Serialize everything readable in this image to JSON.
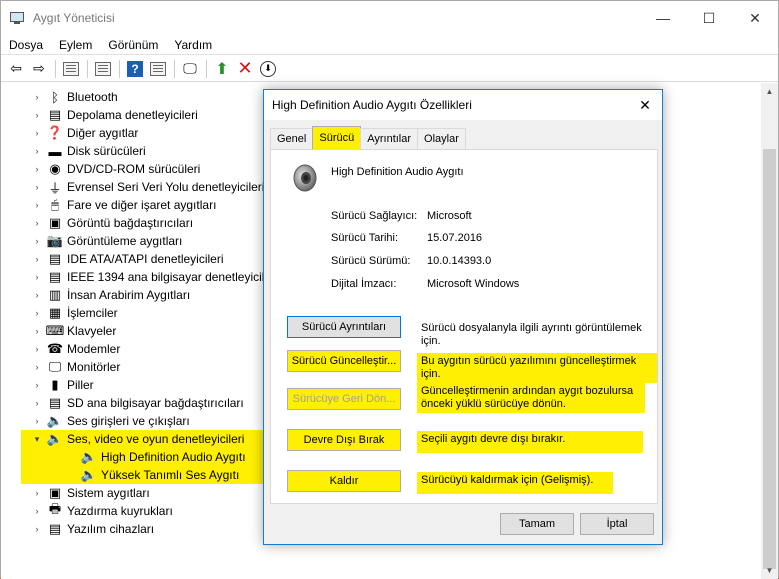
{
  "window": {
    "title": "Aygıt Yöneticisi",
    "minimize": "—",
    "maximize": "☐",
    "close": "✕"
  },
  "menu": [
    "Dosya",
    "Eylem",
    "Görünüm",
    "Yardım"
  ],
  "tree": [
    {
      "label": "Bluetooth",
      "icon": "bluetooth-icon",
      "glyph": "ᛒ"
    },
    {
      "label": "Depolama denetleyicileri",
      "icon": "storage-icon",
      "glyph": "▤"
    },
    {
      "label": "Diğer aygıtlar",
      "icon": "other-device-icon",
      "glyph": "❓"
    },
    {
      "label": "Disk sürücüleri",
      "icon": "disk-icon",
      "glyph": "▬"
    },
    {
      "label": "DVD/CD-ROM sürücüleri",
      "icon": "dvd-icon",
      "glyph": "◉"
    },
    {
      "label": "Evrensel Seri Veri Yolu denetleyicileri",
      "icon": "usb-icon",
      "glyph": "⏚"
    },
    {
      "label": "Fare ve diğer işaret aygıtları",
      "icon": "mouse-icon",
      "glyph": "🖱"
    },
    {
      "label": "Görüntü bağdaştırıcıları",
      "icon": "display-adapter-icon",
      "glyph": "▣"
    },
    {
      "label": "Görüntüleme aygıtları",
      "icon": "imaging-icon",
      "glyph": "📷"
    },
    {
      "label": "IDE ATA/ATAPI denetleyicileri",
      "icon": "ide-icon",
      "glyph": "▤"
    },
    {
      "label": "IEEE 1394 ana bilgisayar denetleyicileri",
      "icon": "ieee-icon",
      "glyph": "▤"
    },
    {
      "label": "İnsan Arabirim Aygıtları",
      "icon": "hid-icon",
      "glyph": "▥"
    },
    {
      "label": "İşlemciler",
      "icon": "cpu-icon",
      "glyph": "▦"
    },
    {
      "label": "Klavyeler",
      "icon": "keyboard-icon",
      "glyph": "⌨"
    },
    {
      "label": "Modemler",
      "icon": "modem-icon",
      "glyph": "☎"
    },
    {
      "label": "Monitörler",
      "icon": "monitor-icon",
      "glyph": "🖵"
    },
    {
      "label": "Piller",
      "icon": "battery-icon",
      "glyph": "▮"
    },
    {
      "label": "SD ana bilgisayar bağdaştırıcıları",
      "icon": "sd-icon",
      "glyph": "▤"
    },
    {
      "label": "Ses girişleri ve çıkışları",
      "icon": "audio-io-icon",
      "glyph": "🔈"
    },
    {
      "label": "Ses, video ve oyun denetleyicileri",
      "icon": "sound-controller-icon",
      "glyph": "🔈",
      "expanded": true
    },
    {
      "label": "High Definition Audio Aygıtı",
      "icon": "speaker-icon",
      "glyph": "🔈",
      "child": true
    },
    {
      "label": "Yüksek Tanımlı Ses Aygıtı",
      "icon": "speaker-icon",
      "glyph": "🔈",
      "child": true
    },
    {
      "label": "Sistem aygıtları",
      "icon": "system-icon",
      "glyph": "▣"
    },
    {
      "label": "Yazdırma kuyrukları",
      "icon": "printer-icon",
      "glyph": "🖶"
    },
    {
      "label": "Yazılım cihazları",
      "icon": "software-device-icon",
      "glyph": "▤"
    }
  ],
  "dialog": {
    "title": "High Definition Audio Aygıtı Özellikleri",
    "close": "✕",
    "tabs": [
      "Genel",
      "Sürücü",
      "Ayrıntılar",
      "Olaylar"
    ],
    "device_name": "High Definition Audio Aygıtı",
    "info": [
      {
        "label": "Sürücü Sağlayıcı:",
        "value": "Microsoft"
      },
      {
        "label": "Sürücü Tarihi:",
        "value": "15.07.2016"
      },
      {
        "label": "Sürücü Sürümü:",
        "value": "10.0.14393.0"
      },
      {
        "label": "Dijital İmzacı:",
        "value": "Microsoft Windows"
      }
    ],
    "actions": [
      {
        "button": "Sürücü Ayrıntıları",
        "desc": "Sürücü dosyalanyla ilgili ayrıntı görüntülemek için."
      },
      {
        "button": "Sürücü Güncelleştir...",
        "desc": "Bu aygıtın sürücü yazılımını güncelleştirmek için."
      },
      {
        "button": "Sürücüye Geri Dön...",
        "desc": "Güncelleştirmenin ardından aygıt bozulursa önceki yüklü sürücüye dönün."
      },
      {
        "button": "Devre Dışı Bırak",
        "desc": "Seçili aygıtı devre dışı bırakır."
      },
      {
        "button": "Kaldır",
        "desc": "Sürücüyü kaldırmak için (Gelişmiş)."
      }
    ],
    "ok": "Tamam",
    "cancel": "İptal"
  },
  "colors": {
    "highlight": "#ffef00",
    "accent": "#1979ca"
  }
}
